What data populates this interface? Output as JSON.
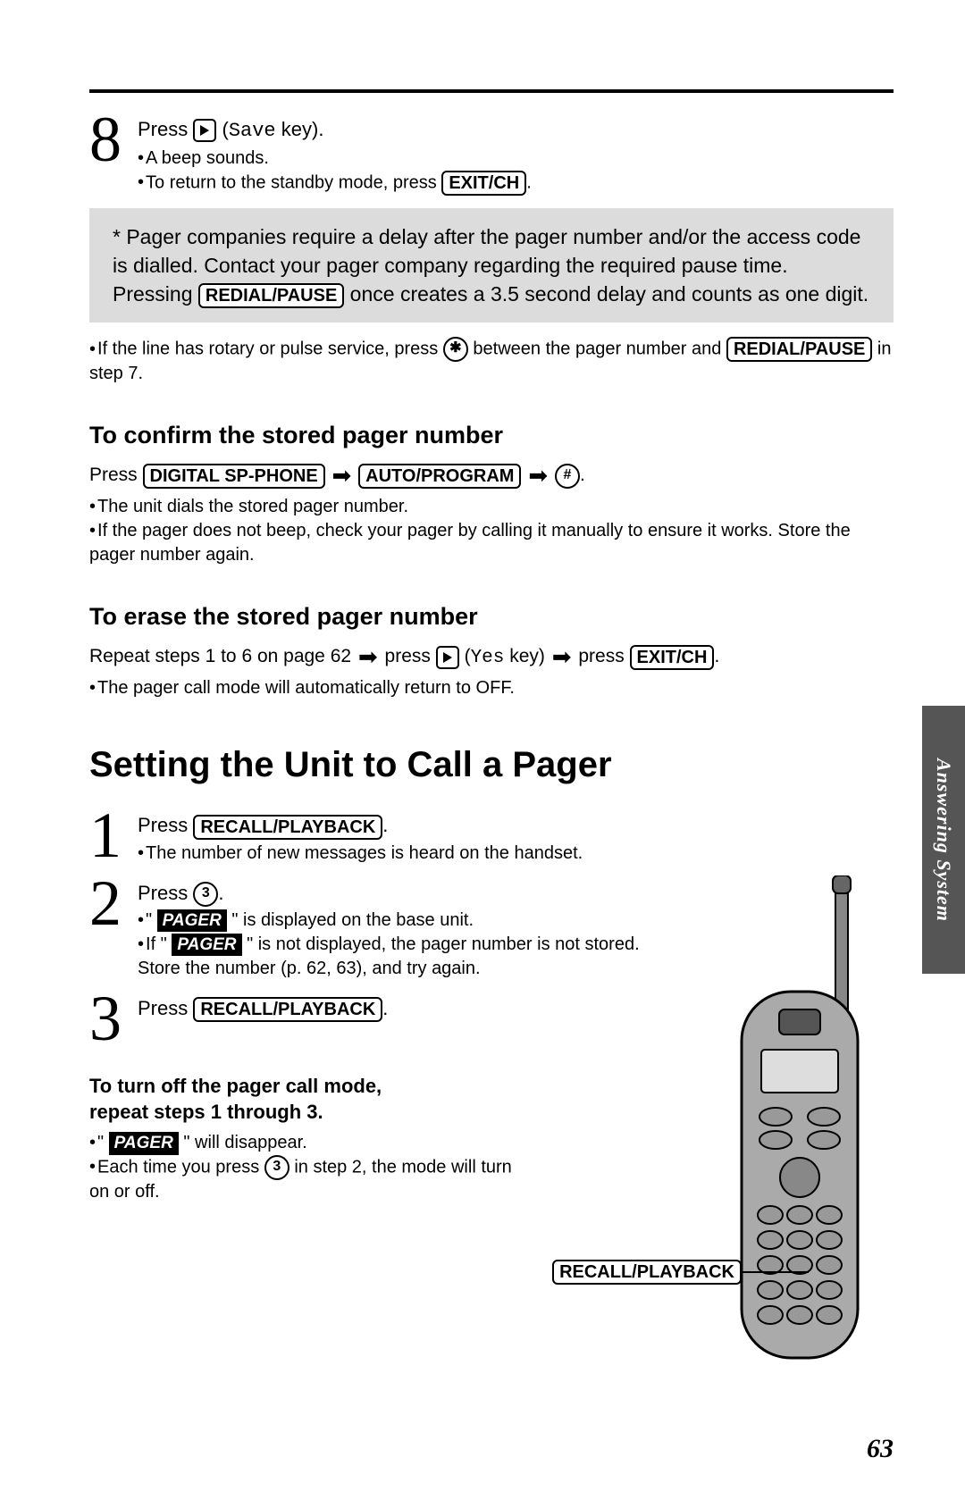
{
  "step8": {
    "prefix": "Press",
    "save_mono": "Save",
    "suffix": " key).",
    "b1": "A beep sounds.",
    "b2a": "To return to the standby mode, press ",
    "exit_key": "EXIT/CH",
    "b2b": "."
  },
  "note": {
    "t1": "* Pager companies require a delay after the pager number and/or the access code is dialled. Contact your pager company regarding the required pause time. Pressing ",
    "redial_key": "REDIAL/PAUSE",
    "t2": " once creates a 3.5 second delay and counts as one digit."
  },
  "rotary": {
    "t1": "If the line has rotary or pulse service, press ",
    "star": "✱",
    "t2": " between the pager number and ",
    "redial_key": "REDIAL/PAUSE",
    "t3": " in step 7."
  },
  "confirm": {
    "heading": "To confirm the stored pager number",
    "press": "Press ",
    "digital_key": "DIGITAL  SP-PHONE",
    "auto_key": "AUTO/PROGRAM",
    "hash": "#",
    "dot": ".",
    "b1": "The unit dials the stored pager number.",
    "b2": "If the pager does not beep, check your pager by calling it manually to ensure it works. Store the pager number again."
  },
  "erase": {
    "heading": "To erase the stored pager number",
    "t1": "Repeat steps 1 to 6 on page 62 ",
    "t2": " press ",
    "yes_mono": "Yes",
    "t3": " key) ",
    "t4": " press ",
    "exit_key": "EXIT/CH",
    "dot": ".",
    "b1": "The pager call mode will automatically return to OFF."
  },
  "setting": {
    "heading": "Setting the Unit to Call a Pager",
    "s1_t1": "Press ",
    "recall_key": "RECALL/PLAYBACK",
    "dot": ".",
    "s1_b1": "The number of new messages is heard on the handset.",
    "s2_t1": "Press ",
    "three": "3",
    "s2_b1a": "\" ",
    "pager_label": "PAGER",
    "s2_b1b": " \" is displayed on the base unit.",
    "s2_b2a": "If \" ",
    "s2_b2b": " \" is not displayed, the pager number is not stored. Store the number (p. 62, 63), and try again.",
    "s3_t1": "Press ",
    "turnoff_h1": "To turn off the pager call mode,",
    "turnoff_h2": "repeat steps 1 through 3.",
    "to_b1a": "\" ",
    "to_b1b": " \" will disappear.",
    "to_b2a": "Each time you press ",
    "to_b2b": " in step 2, the mode will turn on or off."
  },
  "callout_label": "RECALL/PLAYBACK",
  "side_tab": "Answering System",
  "page_number": "63"
}
